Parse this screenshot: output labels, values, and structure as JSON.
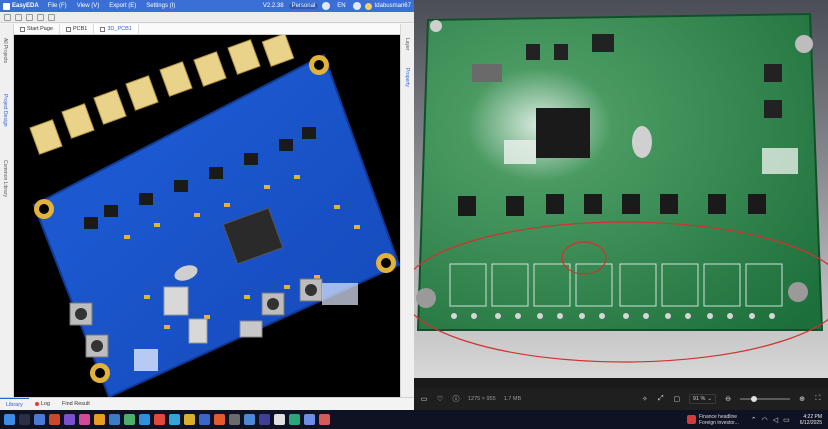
{
  "eda": {
    "logo": "EasyEDA",
    "menus": [
      "File (F)",
      "View (V)",
      "Export (E)",
      "Settings (I)"
    ],
    "version": "V2.2.38",
    "mode": "Personal",
    "lang": "EN",
    "user": "tdabusman67",
    "tabs": [
      "Start Page",
      "PCB1",
      "3D_PCB1"
    ],
    "left_vertical_tabs": [
      "All Projects",
      "Project Design",
      "Common Library"
    ],
    "right_vertical_tabs": [
      "Layer",
      "Property"
    ],
    "bottom_tabs": [
      "Library",
      "Log",
      "Find Result"
    ]
  },
  "viewer": {
    "dimensions": "1275 × 955",
    "filesize": "1.7 MB",
    "zoom": "91 %",
    "zoom_slider_fraction": 0.25
  },
  "taskbar": {
    "apps": [
      {
        "icon": "windows-icon",
        "glyph": "",
        "color": "#3a8ee6"
      },
      {
        "icon": "search-icon",
        "glyph": "",
        "color": "#2a2f45"
      },
      {
        "icon": "app-icon",
        "glyph": "",
        "color": "#4b79d8"
      },
      {
        "icon": "app-icon",
        "glyph": "",
        "color": "#c94a2a"
      },
      {
        "icon": "app-icon",
        "glyph": "",
        "color": "#7b4fcf"
      },
      {
        "icon": "app-icon",
        "glyph": "",
        "color": "#d44a9a"
      },
      {
        "icon": "app-icon",
        "glyph": "",
        "color": "#e89c23"
      },
      {
        "icon": "app-icon",
        "glyph": "",
        "color": "#3a7cc9"
      },
      {
        "icon": "app-icon",
        "glyph": "",
        "color": "#4ab06a"
      },
      {
        "icon": "app-icon",
        "glyph": "",
        "color": "#2f90e0"
      },
      {
        "icon": "app-icon",
        "glyph": "",
        "color": "#e04a3a"
      },
      {
        "icon": "app-icon",
        "glyph": "",
        "color": "#35a4d6"
      },
      {
        "icon": "app-icon",
        "glyph": "",
        "color": "#d8b030"
      },
      {
        "icon": "app-icon",
        "glyph": "",
        "color": "#3a65c9"
      },
      {
        "icon": "app-icon",
        "glyph": "",
        "color": "#e35a2f"
      },
      {
        "icon": "app-icon",
        "glyph": "",
        "color": "#6b6b6b"
      },
      {
        "icon": "app-icon",
        "glyph": "",
        "color": "#4a8ad8"
      },
      {
        "icon": "app-icon",
        "glyph": "",
        "color": "#3f3f9a"
      },
      {
        "icon": "app-icon",
        "glyph": "",
        "color": "#e0e0e0"
      },
      {
        "icon": "app-icon",
        "glyph": "",
        "color": "#2ba67a"
      },
      {
        "icon": "app-icon",
        "glyph": "",
        "color": "#6b8ee8"
      },
      {
        "icon": "app-icon",
        "glyph": "",
        "color": "#d65a5a"
      }
    ],
    "news_title": "Finance headline",
    "news_sub": "Foreign investor...",
    "time": "4:22 PM",
    "date": "6/12/2025"
  }
}
